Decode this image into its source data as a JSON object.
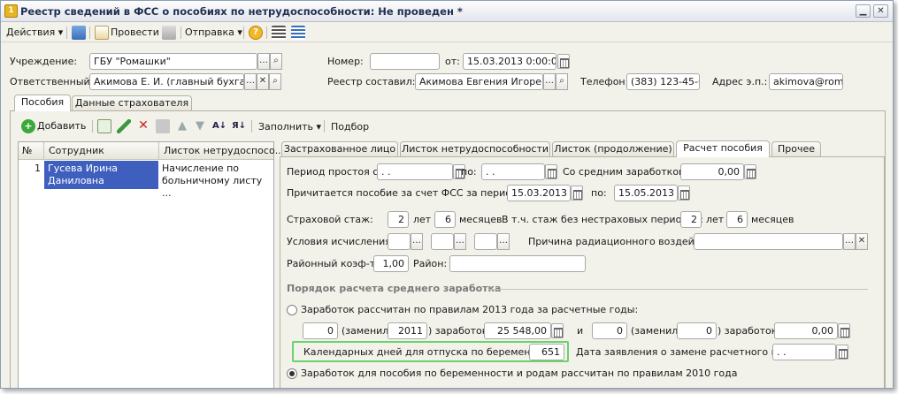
{
  "window": {
    "title": "Реестр сведений в ФСС о пособиях по нетрудоспособности: Не проведен *"
  },
  "toolbar": {
    "actions": "Действия",
    "post": "Провести",
    "send": "Отправка"
  },
  "header": {
    "institution_label": "Учреждение:",
    "institution_value": "ГБУ \"Ромашки\"",
    "number_label": "Номер:",
    "number_value": "",
    "date_label": "от:",
    "date_value": "15.03.2013  0:00:00",
    "responsible_label": "Ответственный:",
    "responsible_value": "Акимова Е. И. (главный бухгалтер",
    "compiler_label": "Реестр составил:",
    "compiler_value": "Акимова Евгения Игоревна",
    "phone_label": "Телефон:",
    "phone_value": "(383) 123-45-67",
    "email_label": "Адрес э.п.:",
    "email_value": "akimova@romas"
  },
  "main_tabs": [
    "Пособия",
    "Данные страхователя"
  ],
  "list_toolbar": {
    "add": "Добавить",
    "fill": "Заполнить",
    "select": "Подбор"
  },
  "grid": {
    "columns": [
      "№",
      "Сотрудник",
      "Листок нетрудоспосо..."
    ],
    "rows": [
      {
        "n": "1",
        "employee": "Гусева Ирина Даниловна",
        "sheet": "Начисление по больничному листу ..."
      }
    ]
  },
  "detail_tabs": [
    "Застрахованное лицо",
    "Листок нетрудоспособности",
    "Листок (продолжение)",
    "Расчет пособия",
    "Прочее"
  ],
  "calc": {
    "idle_from_label": "Период простоя с:",
    "idle_from_value": " .  .",
    "idle_to_label": "по:",
    "idle_to_value": " .  .",
    "avg_label": "Со средним заработком:",
    "avg_value": "0,00",
    "due_label": "Причитается пособие за счет ФСС за период: с",
    "due_from": "15.03.2013",
    "due_to_label": "по:",
    "due_to": "15.05.2013",
    "exp_label": "Страховой стаж:",
    "exp_years": "2",
    "years_word": "лет",
    "exp_months": "6",
    "months_word": "месяцев",
    "nonins_label": "В т.ч. стаж без нестраховых периодов:",
    "nonins_years": "2",
    "nonins_months": "6",
    "cond_label": "Условия исчисления:",
    "rad_label": "Причина радиационного воздействия:",
    "rad_value": "",
    "coef_label": "Районный коэф-т:",
    "coef_value": "1,00",
    "district_label": "Район:",
    "district_value": "",
    "section_title": "Порядок расчета среднего заработка",
    "radio2013_label": "Заработок рассчитан по правилам 2013 года за расчетные годы:",
    "y1_value": "0",
    "replaced_label": "(заменил",
    "y1_replaced": "2011",
    "earnings_label": ") заработок:",
    "y1_earnings": "25 548,00",
    "and_word": "и",
    "y2_value": "0",
    "y2_replaced": "0",
    "y2_earnings": "0,00",
    "calendar_label": "Календарных дней для отпуска по беременности:",
    "calendar_value": "651",
    "app_date_label": "Дата заявления о замене расчетного года:",
    "app_date_value": " .  .",
    "radio2010_label": "Заработок для пособия по беременности и родам рассчитан по правилам 2010 года"
  },
  "colors": {
    "selection": "#3f5fbf",
    "highlight": "#6ad36a",
    "section": "#7a7a7a",
    "accent": "#e8b41f"
  }
}
